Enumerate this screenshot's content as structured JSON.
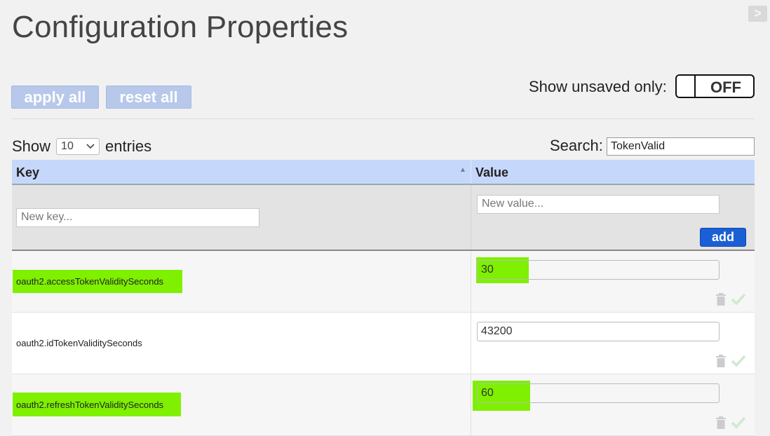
{
  "header": {
    "title": "Configuration Properties",
    "corner_button_glyph": ">"
  },
  "toolbar": {
    "apply_label": "apply all",
    "reset_label": "reset all",
    "unsaved_label": "Show unsaved only:",
    "toggle_state": "OFF"
  },
  "list_controls": {
    "show_label": "Show",
    "entries_value": "10",
    "entries_label": "entries",
    "search_label": "Search:",
    "search_value": "TokenValid"
  },
  "table": {
    "columns": [
      "Key",
      "Value"
    ],
    "new_key_placeholder": "New key...",
    "new_value_placeholder": "New value...",
    "add_label": "add",
    "rows": [
      {
        "key": "oauth2.accessTokenValiditySeconds",
        "value": "30",
        "highlighted": true
      },
      {
        "key": "oauth2.idTokenValiditySeconds",
        "value": "43200",
        "highlighted": false
      },
      {
        "key": "oauth2.refreshTokenValiditySeconds",
        "value": "60",
        "highlighted": true
      }
    ]
  },
  "colors": {
    "highlight": "#7ef000",
    "header_bg": "#c5d8fb",
    "add_button": "#1a5fd6",
    "light_button": "#b7c8ea"
  }
}
